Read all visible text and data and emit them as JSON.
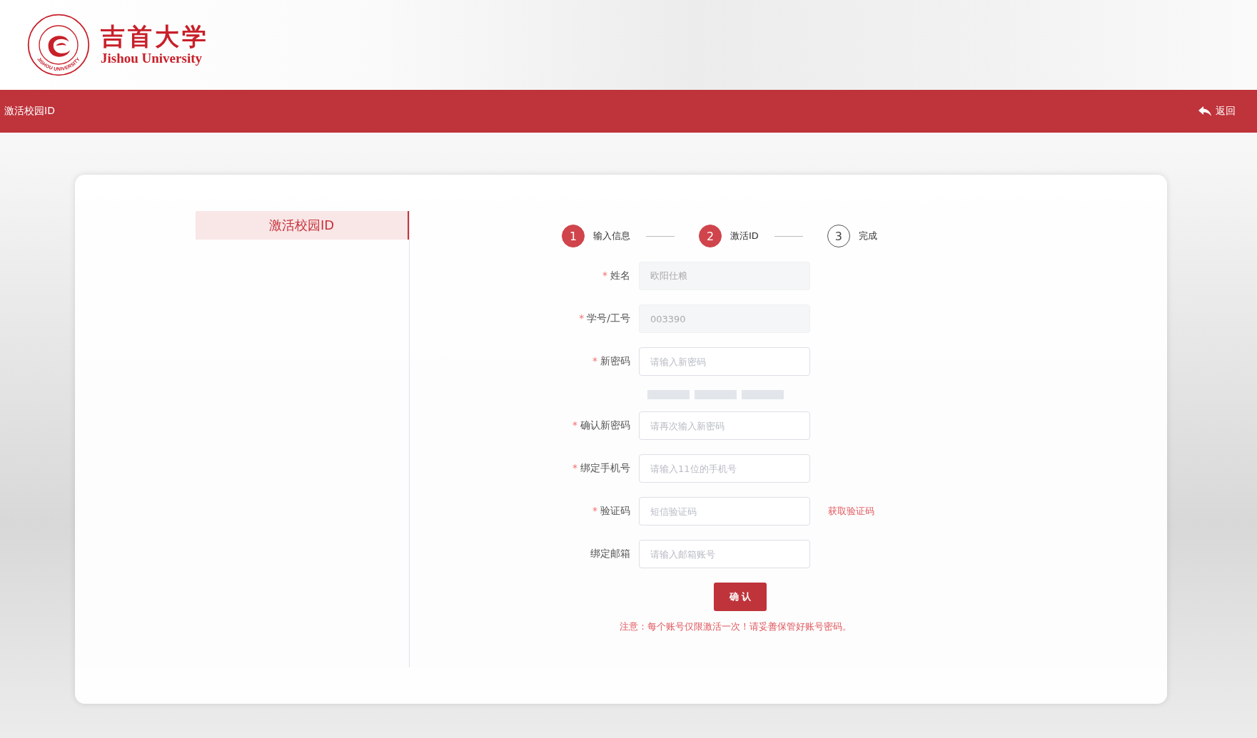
{
  "logo": {
    "seal_text": "JISHOU UNIVERSITY",
    "name_cn": "吉首大学",
    "name_en": "Jishou University"
  },
  "title_bar": {
    "title": "激活校园ID",
    "back": "返回"
  },
  "sidebar": {
    "items": [
      {
        "label": "激活校园ID",
        "selected": true
      }
    ]
  },
  "steps": [
    {
      "number": "1",
      "label": "输入信息",
      "reached": true
    },
    {
      "number": "2",
      "label": "激活ID",
      "reached": true
    },
    {
      "number": "3",
      "label": "完成",
      "reached": false
    }
  ],
  "form": {
    "fields": [
      {
        "label": "姓名",
        "required_mark": "*",
        "disabled": true,
        "value": "欧阳仕粮"
      },
      {
        "label": "学号/工号",
        "required_mark": "*",
        "disabled": true,
        "value": "003390"
      },
      {
        "label": "新密码",
        "required_mark": "*",
        "disabled": false,
        "placeholder": "请输入新密码",
        "kind": "password"
      },
      {
        "label": "确认新密码",
        "required_mark": "*",
        "disabled": false,
        "placeholder": "请再次输入新密码"
      },
      {
        "label": "绑定手机号",
        "required_mark": "*",
        "disabled": false,
        "placeholder": "请输入11位的手机号"
      },
      {
        "label": "验证码",
        "required_mark": "*",
        "disabled": false,
        "placeholder": "短信验证码",
        "action": "获取验证码"
      },
      {
        "label": "绑定邮箱",
        "disabled": false,
        "placeholder": "请输入邮箱账号"
      }
    ],
    "password_strength": {
      "level": 0
    },
    "submit": "确 认",
    "note": "注意：每个账号仅限激活一次！请妥善保管好账号密码。"
  }
}
